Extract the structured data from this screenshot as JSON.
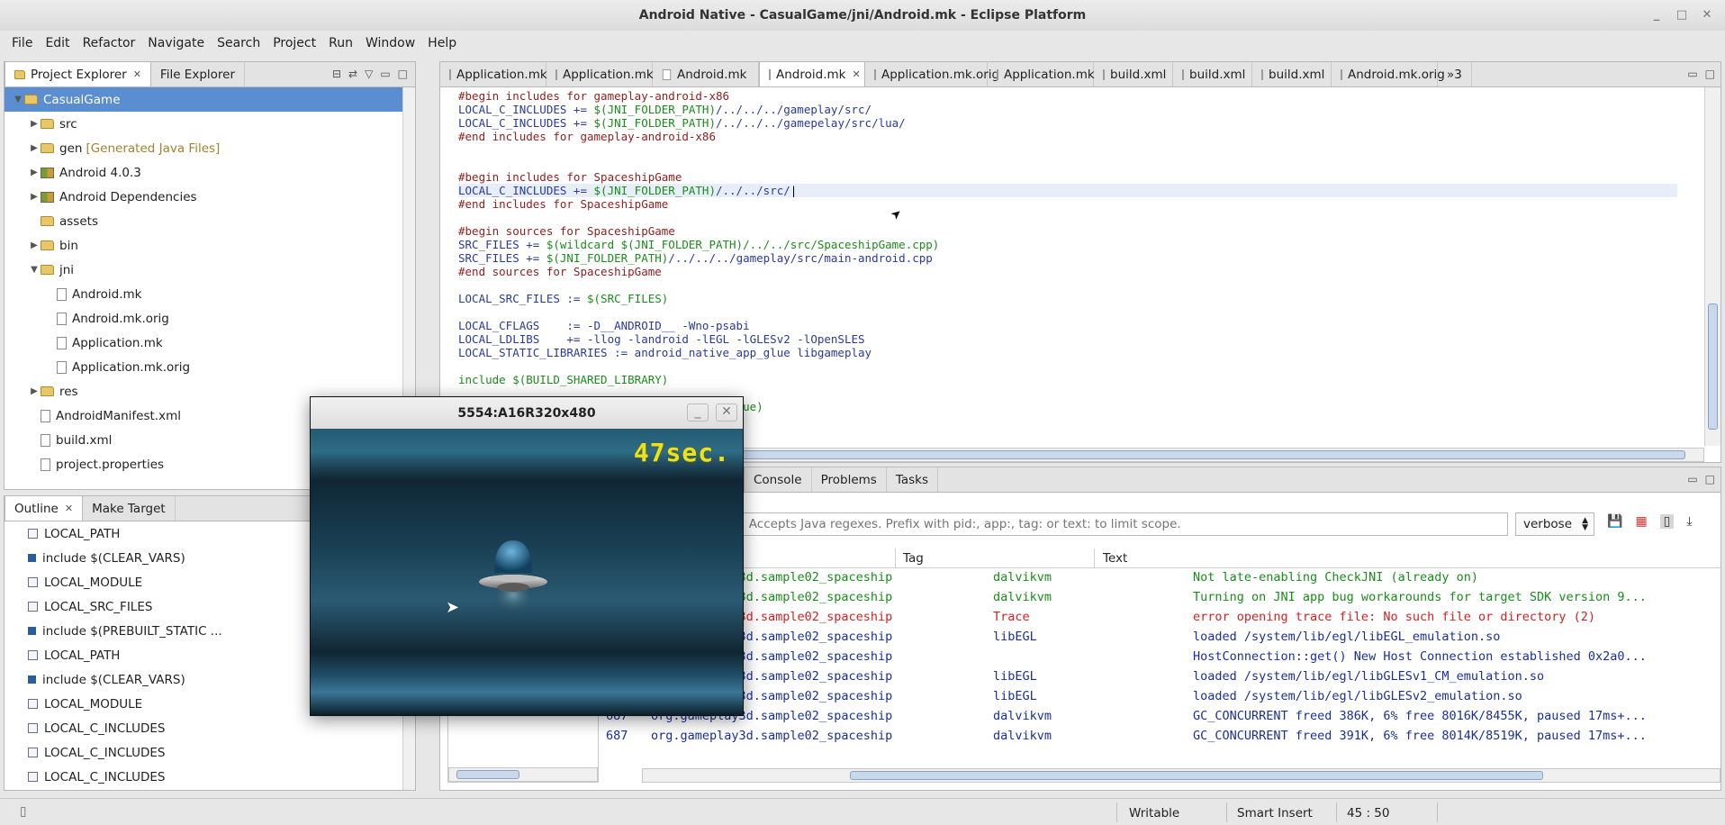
{
  "window": {
    "title": "Android Native - CasualGame/jni/Android.mk - Eclipse Platform"
  },
  "menu": [
    "File",
    "Edit",
    "Refactor",
    "Navigate",
    "Search",
    "Project",
    "Run",
    "Window",
    "Help"
  ],
  "left_tabs": {
    "explorer": "Project Explorer",
    "file_explorer": "File Explorer"
  },
  "tree": [
    {
      "label": "CasualGame",
      "indent": 0,
      "tri": "▼",
      "icon": "project",
      "sel": true
    },
    {
      "label": "src",
      "indent": 1,
      "tri": "▶",
      "icon": "folder"
    },
    {
      "label": "gen",
      "extra": "[Generated Java Files]",
      "indent": 1,
      "tri": "▶",
      "icon": "folder"
    },
    {
      "label": "Android 4.0.3",
      "indent": 1,
      "tri": "▶",
      "icon": "lib"
    },
    {
      "label": "Android Dependencies",
      "indent": 1,
      "tri": "▶",
      "icon": "lib"
    },
    {
      "label": "assets",
      "indent": 1,
      "tri": "",
      "icon": "folder"
    },
    {
      "label": "bin",
      "indent": 1,
      "tri": "▶",
      "icon": "folder"
    },
    {
      "label": "jni",
      "indent": 1,
      "tri": "▼",
      "icon": "folder"
    },
    {
      "label": "Android.mk",
      "indent": 2,
      "tri": "",
      "icon": "file"
    },
    {
      "label": "Android.mk.orig",
      "indent": 2,
      "tri": "",
      "icon": "file"
    },
    {
      "label": "Application.mk",
      "indent": 2,
      "tri": "",
      "icon": "file"
    },
    {
      "label": "Application.mk.orig",
      "indent": 2,
      "tri": "",
      "icon": "file"
    },
    {
      "label": "res",
      "indent": 1,
      "tri": "▶",
      "icon": "folder"
    },
    {
      "label": "AndroidManifest.xml",
      "indent": 1,
      "tri": "",
      "icon": "file"
    },
    {
      "label": "build.xml",
      "indent": 1,
      "tri": "",
      "icon": "file"
    },
    {
      "label": "project.properties",
      "indent": 1,
      "tri": "",
      "icon": "file"
    }
  ],
  "outline_tabs": {
    "outline": "Outline",
    "make_target": "Make Target"
  },
  "outline": [
    {
      "label": "LOCAL_PATH",
      "icon": "var"
    },
    {
      "label": "include $(CLEAR_VARS)",
      "icon": "inc"
    },
    {
      "label": "LOCAL_MODULE",
      "icon": "var"
    },
    {
      "label": "LOCAL_SRC_FILES",
      "icon": "var"
    },
    {
      "label": "include $(PREBUILT_STATIC ...",
      "icon": "inc"
    },
    {
      "label": "LOCAL_PATH",
      "icon": "var"
    },
    {
      "label": "include $(CLEAR_VARS)",
      "icon": "inc"
    },
    {
      "label": "LOCAL_MODULE",
      "icon": "var"
    },
    {
      "label": "LOCAL_C_INCLUDES",
      "icon": "var"
    },
    {
      "label": "LOCAL_C_INCLUDES",
      "icon": "var"
    },
    {
      "label": "LOCAL_C_INCLUDES",
      "icon": "var"
    }
  ],
  "editor_tabs": [
    "Application.mk",
    "Application.mk",
    "Android.mk",
    "Android.mk",
    "Application.mk.orig",
    "Application.mk",
    "build.xml",
    "build.xml",
    "build.xml",
    "Android.mk.orig"
  ],
  "editor_tab_overflow": "»3",
  "code": [
    [
      [
        "cm",
        "#begin includes for gameplay-android-x86"
      ]
    ],
    [
      [
        "kw",
        "LOCAL_C_INCLUDES += "
      ],
      [
        "vr",
        "$(JNI_FOLDER_PATH)"
      ],
      [
        "kw",
        "/../../../gameplay/src/"
      ]
    ],
    [
      [
        "kw",
        "LOCAL_C_INCLUDES += "
      ],
      [
        "vr",
        "$(JNI_FOLDER_PATH)"
      ],
      [
        "kw",
        "/../../../gamepelay/src/lua/"
      ]
    ],
    [
      [
        "cm",
        "#end includes for gameplay-android-x86"
      ]
    ],
    [],
    [],
    [
      [
        "cm",
        "#begin includes for SpaceshipGame"
      ]
    ],
    [
      [
        "kw",
        "LOCAL_C_INCLUDES += "
      ],
      [
        "vr",
        "$(JNI_FOLDER_PATH)"
      ],
      [
        "kw",
        "/../../src/"
      ]
    ],
    [
      [
        "cm",
        "#end includes for SpaceshipGame"
      ]
    ],
    [],
    [
      [
        "cm",
        "#begin sources for SpaceshipGame"
      ]
    ],
    [
      [
        "kw",
        "SRC_FILES += "
      ],
      [
        "vr",
        "$(wildcard $(JNI_FOLDER_PATH)/../../src/SpaceshipGame.cpp)"
      ]
    ],
    [
      [
        "kw",
        "SRC_FILES += "
      ],
      [
        "vr",
        "$(JNI_FOLDER_PATH)"
      ],
      [
        "kw",
        "/../../../gameplay/src/main-android.cpp"
      ]
    ],
    [
      [
        "cm",
        "#end sources for SpaceshipGame"
      ]
    ],
    [],
    [
      [
        "kw",
        "LOCAL_SRC_FILES := "
      ],
      [
        "vr",
        "$(SRC_FILES)"
      ]
    ],
    [],
    [
      [
        "kw",
        "LOCAL_CFLAGS    := -D__ANDROID__ -Wno-psabi"
      ]
    ],
    [
      [
        "kw",
        "LOCAL_LDLIBS    += -llog -landroid -lEGL -lGLESv2 -lOpenSLES"
      ]
    ],
    [
      [
        "kw",
        "LOCAL_STATIC_LIBRARIES := android_native_app_glue libgameplay"
      ]
    ],
    [],
    [
      [
        "vr",
        "include $(BUILD_SHARED_LIBRARY)"
      ]
    ],
    [],
    [
      [
        "vr",
        "$(call import-module,android/native_app_glue)"
      ]
    ]
  ],
  "console_tabs": {
    "console": "Console",
    "problems": "Problems",
    "tasks": "Tasks"
  },
  "logcat": {
    "filter_placeholder": "Search for messages. Accepts Java regexes. Prefix with pid:, app:, tag: or text: to limit scope.",
    "level": "verbose",
    "headers": {
      "app": "Application",
      "tag": "Tag",
      "text": "Text"
    },
    "rows": [
      {
        "pid": "687",
        "app": "org.gameplay3d.sample02_spaceship",
        "tag": "dalvikvm",
        "text": "Not late-enabling CheckJNI (already on)",
        "color": "#1b8c1b"
      },
      {
        "pid": "687",
        "app": "org.gameplay3d.sample02_spaceship",
        "tag": "dalvikvm",
        "text": "Turning on JNI app bug workarounds for target SDK version 9...",
        "color": "#1b8c1b"
      },
      {
        "pid": "687",
        "app": "org.gameplay3d.sample02_spaceship",
        "tag": "Trace",
        "text": "error opening trace file: No such file or directory (2)",
        "color": "#d42020"
      },
      {
        "pid": "687",
        "app": "org.gameplay3d.sample02_spaceship",
        "tag": "libEGL",
        "text": "loaded /system/lib/egl/libEGL_emulation.so",
        "color": "#1a2f9a"
      },
      {
        "pid": "687",
        "app": "org.gameplay3d.sample02_spaceship",
        "tag": "",
        "text": "HostConnection::get() New Host Connection established 0x2a0...",
        "color": "#1a2f9a"
      },
      {
        "pid": "687",
        "app": "org.gameplay3d.sample02_spaceship",
        "tag": "libEGL",
        "text": "loaded /system/lib/egl/libGLESv1_CM_emulation.so",
        "color": "#1a2f9a"
      },
      {
        "pid": "687",
        "app": "org.gameplay3d.sample02_spaceship",
        "tag": "libEGL",
        "text": "loaded /system/lib/egl/libGLESv2_emulation.so",
        "color": "#1a2f9a"
      },
      {
        "pid": "687",
        "app": "org.gameplay3d.sample02_spaceship",
        "tag": "dalvikvm",
        "text": "GC_CONCURRENT freed 386K, 6% free 8016K/8455K, paused 17ms+...",
        "color": "#1a2f9a"
      },
      {
        "pid": "687",
        "app": "org.gameplay3d.sample02_spaceship",
        "tag": "dalvikvm",
        "text": "GC_CONCURRENT freed 391K, 6% free 8014K/8519K, paused 17ms+...",
        "color": "#1a2f9a"
      }
    ]
  },
  "status": {
    "writable": "Writable",
    "insert": "Smart Insert",
    "position": "45 : 50"
  },
  "emulator": {
    "title": "5554:A16R320x480",
    "timer": "47sec."
  }
}
